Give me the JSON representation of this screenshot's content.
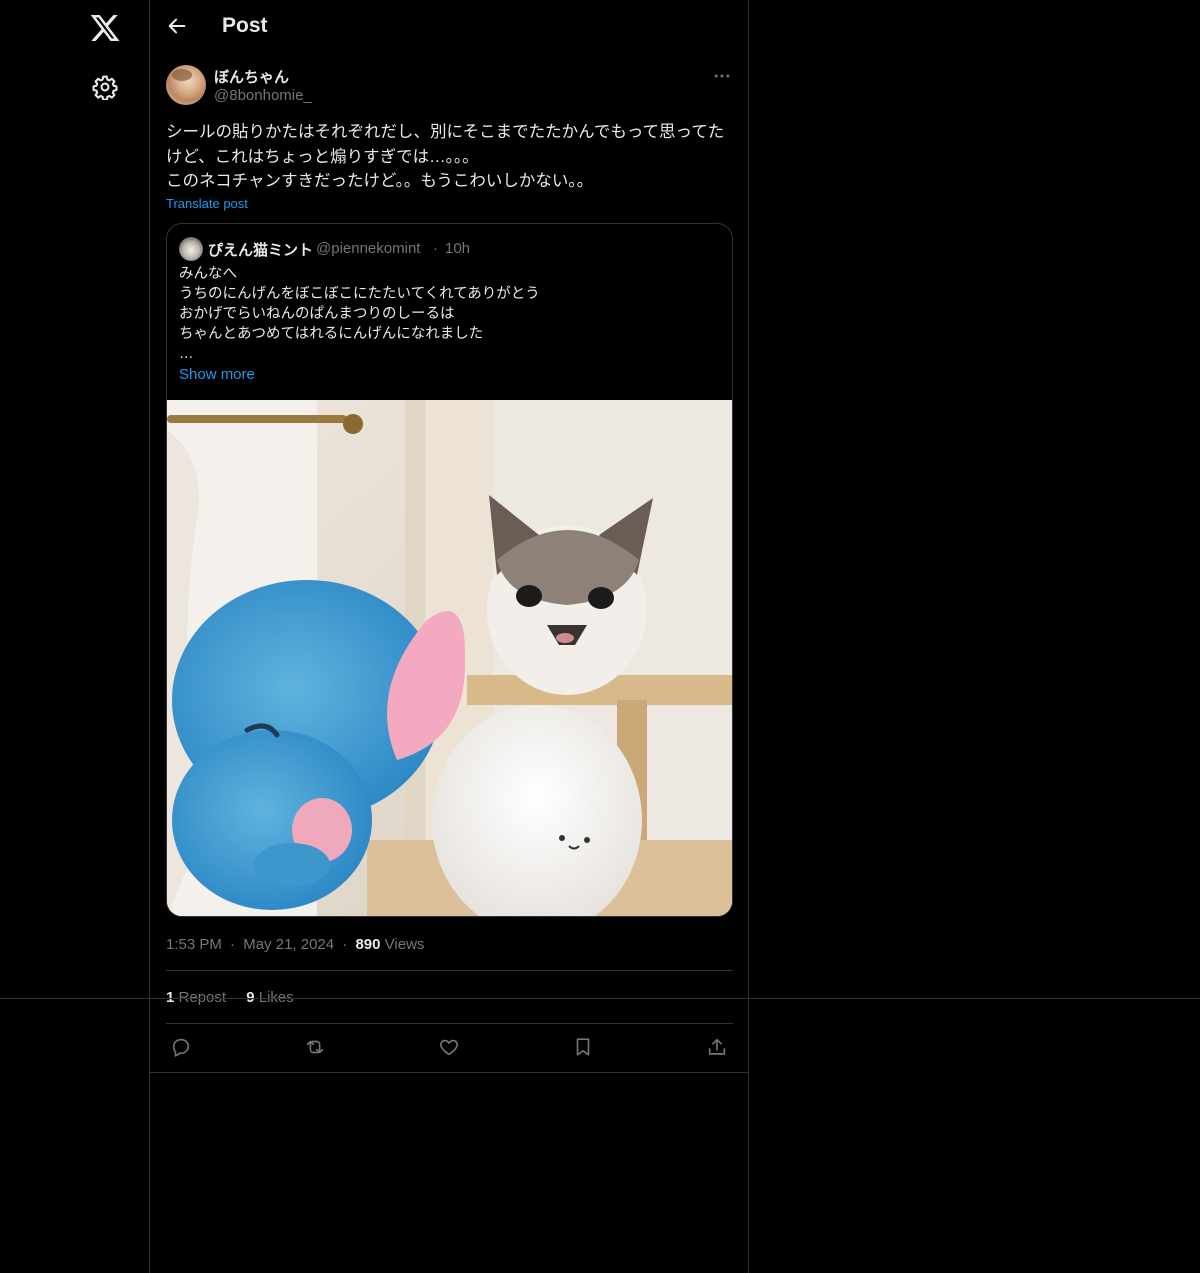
{
  "nav": {
    "logo_icon": "x-logo-icon",
    "settings_icon": "gear-icon"
  },
  "header": {
    "back_icon": "arrow-left-icon",
    "title": "Post"
  },
  "post": {
    "author": {
      "display_name": "ぼんちゃん",
      "handle": "@8bonhomie_"
    },
    "more_icon": "more-horizontal-icon",
    "text": "シールの貼りかたはそれぞれだし、別にそこまでたたかんでもって思ってたけど、これはちょっと煽りすぎでは…。。。\nこのネコチャンすきだったけど。。もうこわいしかない。。",
    "translate_label": "Translate post",
    "quote": {
      "display_name": "ぴえん猫ミント",
      "handle": "@piennekomint",
      "separator": "·",
      "time": "10h",
      "text": "みんなへ\nうちのにんげんをぼこぼこにたたいてくれてありがとう\nおかげでらいねんのぱんまつりのしーるは\nちゃんとあつめてはれるにんげんになれました\n…",
      "show_more": "Show more",
      "media_description": "cat-photo"
    },
    "meta": {
      "time": "1:53 PM",
      "dot": "·",
      "date": "May 21, 2024",
      "views_count": "890",
      "views_label": "Views"
    },
    "stats": {
      "reposts_count": "1",
      "reposts_label": "Repost",
      "likes_count": "9",
      "likes_label": "Likes"
    },
    "actions": [
      "reply-icon",
      "repost-icon",
      "like-icon",
      "bookmark-icon",
      "share-icon"
    ]
  }
}
